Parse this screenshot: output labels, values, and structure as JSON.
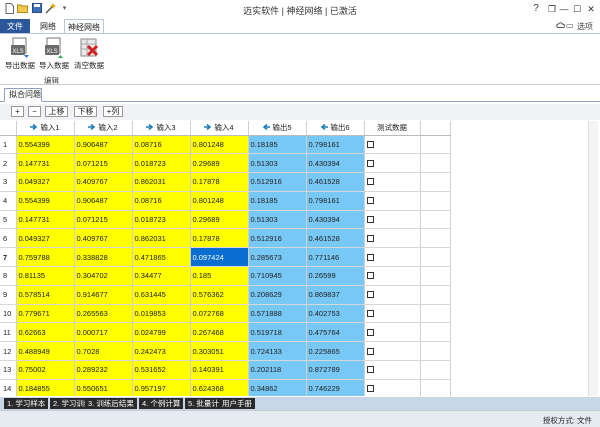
{
  "titlebar": {
    "title": "迈实软件 | 神经网络 | 已激活",
    "quick_access": [
      "new-doc-icon",
      "open-folder-icon",
      "save-icon",
      "magic-wand-icon"
    ],
    "window_controls": {
      "help": "?",
      "restore": "❐",
      "minimize": "—",
      "maximize": "☐",
      "close": "✕"
    }
  },
  "ribbon": {
    "tabs": [
      {
        "label": "文件"
      },
      {
        "label": "网络"
      },
      {
        "label": "神经网络"
      }
    ],
    "active_tab": "神经网络",
    "options_label": "选项",
    "buttons": [
      {
        "label": "导出数据",
        "icon": "xls-export-icon"
      },
      {
        "label": "导入数据",
        "icon": "xls-import-icon"
      },
      {
        "label": "清空数据",
        "icon": "clear-data-icon"
      }
    ],
    "group_label": "编辑"
  },
  "doc_tab": {
    "label": "拟合问题"
  },
  "toolbar": {
    "add": "+",
    "remove": "−",
    "move_up": "上移",
    "move_down": "下移",
    "add_col": "+列"
  },
  "grid": {
    "columns": [
      {
        "label": "输入1",
        "kind": "input"
      },
      {
        "label": "输入2",
        "kind": "input"
      },
      {
        "label": "输入3",
        "kind": "input"
      },
      {
        "label": "输入4",
        "kind": "input"
      },
      {
        "label": "输出5",
        "kind": "output"
      },
      {
        "label": "输出6",
        "kind": "output"
      },
      {
        "label": "测试数据",
        "kind": "test"
      }
    ],
    "rows": [
      {
        "n": "1",
        "v": [
          "0.554399",
          "0.906487",
          "0.08716",
          "0.801248",
          "0.18185",
          "0.798161"
        ]
      },
      {
        "n": "2",
        "v": [
          "0.147731",
          "0.071215",
          "0.018723",
          "0.29689",
          "0.51303",
          "0.430394"
        ]
      },
      {
        "n": "3",
        "v": [
          "0.049327",
          "0.409767",
          "0.862031",
          "0.17878",
          "0.512916",
          "0.461528"
        ]
      },
      {
        "n": "4",
        "v": [
          "0.554399",
          "0.906487",
          "0.08716",
          "0.801248",
          "0.18185",
          "0.798161"
        ]
      },
      {
        "n": "5",
        "v": [
          "0.147731",
          "0.071215",
          "0.018723",
          "0.29689",
          "0.51303",
          "0.430394"
        ]
      },
      {
        "n": "6",
        "v": [
          "0.049327",
          "0.409767",
          "0.862031",
          "0.17878",
          "0.512916",
          "0.461528"
        ]
      },
      {
        "n": "7",
        "v": [
          "0.759788",
          "0.338828",
          "0.471865",
          "0.097424",
          "0.285673",
          "0.771146"
        ]
      },
      {
        "n": "8",
        "v": [
          "0.81135",
          "0.304702",
          "0.34477",
          "0.185",
          "0.710945",
          "0.26599"
        ]
      },
      {
        "n": "9",
        "v": [
          "0.578514",
          "0.914677",
          "0.631445",
          "0.576362",
          "0.208629",
          "0.869837"
        ]
      },
      {
        "n": "10",
        "v": [
          "0.779671",
          "0.265563",
          "0.019853",
          "0.072768",
          "0.571888",
          "0.402753"
        ]
      },
      {
        "n": "11",
        "v": [
          "0.62663",
          "0.000717",
          "0.024799",
          "0.267468",
          "0.519718",
          "0.475764"
        ]
      },
      {
        "n": "12",
        "v": [
          "0.488949",
          "0.7028",
          "0.242473",
          "0.303051",
          "0.724133",
          "0.225865"
        ]
      },
      {
        "n": "13",
        "v": [
          "0.75002",
          "0.289232",
          "0.531652",
          "0.140391",
          "0.202118",
          "0.872789"
        ]
      },
      {
        "n": "14",
        "v": [
          "0.184855",
          "0.550651",
          "0.957197",
          "0.624368",
          "0.34862",
          "0.746229"
        ]
      },
      {
        "n": "15",
        "v": [
          "0.164962",
          "0.464414",
          "0.641588",
          "0.238785",
          "0.792014",
          "0.211571"
        ]
      }
    ],
    "selected": {
      "row": 6,
      "col": 3
    },
    "bold_row": 6
  },
  "bottom_tabs": [
    "1. 学习样本",
    "2. 学习训练",
    "3. 训练后结果",
    "4. 个例计算",
    "5. 批量计算",
    "用户手册"
  ],
  "status": {
    "text": "授权方式: 文件"
  },
  "colors": {
    "input": "#ffff00",
    "output": "#78c8f5",
    "selected": "#0a6ed1",
    "file_tab": "#2b579a"
  }
}
